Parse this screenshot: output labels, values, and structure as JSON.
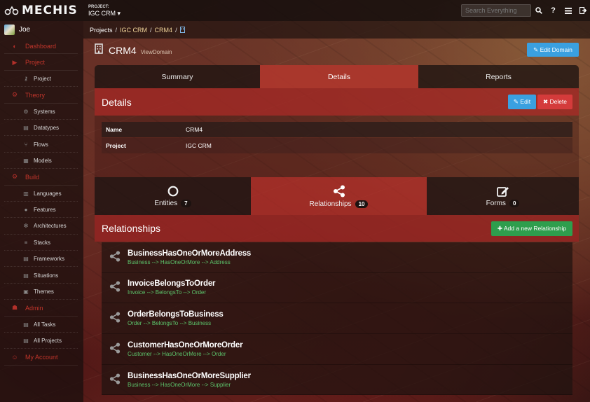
{
  "app": {
    "logo_text": "MECHIS",
    "project_caption": "PROJECT:",
    "project_value": "IGC CRM ▾",
    "search_placeholder": "Search Everything",
    "help_label": "?"
  },
  "sidebar": {
    "user_name": "Joe",
    "items": [
      {
        "label": "Dashboard",
        "kind": "section",
        "icon": "dashboard-icon"
      },
      {
        "label": "Project",
        "kind": "section",
        "icon": "project-icon"
      },
      {
        "label": "Project",
        "kind": "sub",
        "icon": "key-icon"
      },
      {
        "label": "Theory",
        "kind": "section",
        "icon": "theory-icon"
      },
      {
        "label": "Systems",
        "kind": "sub",
        "icon": "cogs-icon"
      },
      {
        "label": "Datatypes",
        "kind": "sub",
        "icon": "datatype-icon"
      },
      {
        "label": "Flows",
        "kind": "sub",
        "icon": "flow-icon"
      },
      {
        "label": "Models",
        "kind": "sub",
        "icon": "model-icon"
      },
      {
        "label": "Build",
        "kind": "section",
        "icon": "build-icon"
      },
      {
        "label": "Languages",
        "kind": "sub",
        "icon": "language-icon"
      },
      {
        "label": "Features",
        "kind": "sub",
        "icon": "feature-icon"
      },
      {
        "label": "Architectures",
        "kind": "sub",
        "icon": "architecture-icon"
      },
      {
        "label": "Stacks",
        "kind": "sub",
        "icon": "stack-icon"
      },
      {
        "label": "Frameworks",
        "kind": "sub",
        "icon": "framework-icon"
      },
      {
        "label": "Situations",
        "kind": "sub",
        "icon": "situation-icon"
      },
      {
        "label": "Themes",
        "kind": "sub",
        "icon": "theme-icon"
      },
      {
        "label": "Admin",
        "kind": "section",
        "icon": "admin-icon"
      },
      {
        "label": "All Tasks",
        "kind": "sub",
        "icon": "tasks-icon"
      },
      {
        "label": "All Projects",
        "kind": "sub",
        "icon": "projects-icon"
      },
      {
        "label": "My Account",
        "kind": "section",
        "icon": "account-icon"
      }
    ]
  },
  "breadcrumb": {
    "projects": "Projects",
    "igc_crm": "IGC CRM",
    "crm4": "CRM4",
    "sep": "/"
  },
  "header": {
    "title": "CRM4",
    "subtitle": "ViewDomain",
    "edit_domain_label": "✎ Edit Domain"
  },
  "tabs": [
    {
      "label": "Summary",
      "active": false
    },
    {
      "label": "Details",
      "active": true
    },
    {
      "label": "Reports",
      "active": false
    }
  ],
  "details": {
    "title": "Details",
    "edit_label": "✎ Edit",
    "delete_label": "✖ Delete",
    "rows": [
      {
        "key": "Name",
        "value": "CRM4"
      },
      {
        "key": "Project",
        "value": "IGC CRM"
      }
    ]
  },
  "stats": [
    {
      "label": "Entities",
      "count": "7",
      "icon": "circle-icon"
    },
    {
      "label": "Relationships",
      "count": "10",
      "icon": "share-icon"
    },
    {
      "label": "Forms",
      "count": "0",
      "icon": "edit-form-icon"
    }
  ],
  "relationships": {
    "title": "Relationships",
    "add_label": "✚ Add a new Relationship",
    "items": [
      {
        "name": "BusinessHasOneOrMoreAddress",
        "desc": "Business --> HasOneOrMore --> Address"
      },
      {
        "name": "InvoiceBelongsToOrder",
        "desc": "Invoice --> BelongsTo --> Order"
      },
      {
        "name": "OrderBelongsToBusiness",
        "desc": "Order --> BelongsTo --> Business"
      },
      {
        "name": "CustomerHasOneOrMoreOrder",
        "desc": "Customer --> HasOneOrMore --> Order"
      },
      {
        "name": "BusinessHasOneOrMoreSupplier",
        "desc": "Business --> HasOneOrMore --> Supplier"
      }
    ]
  },
  "colors": {
    "accent_red": "#c2352b",
    "info_blue": "#3aa0e0",
    "danger_red": "#d43b3b",
    "success_green": "#2e9e4d",
    "relation_text_green": "#5cc46b"
  }
}
